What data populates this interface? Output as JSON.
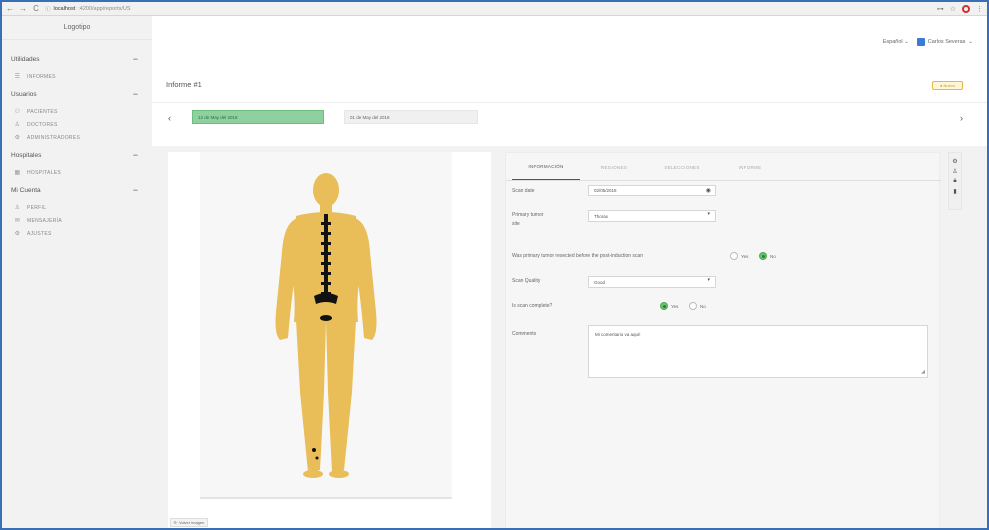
{
  "browser": {
    "host": "localhost",
    "path": ":4200/app/reports/US"
  },
  "sidebar": {
    "logo": "Logotipo",
    "sections": [
      {
        "title": "Utilidades",
        "items": [
          {
            "label": "INFORMES",
            "icon": "list-icon"
          }
        ]
      },
      {
        "title": "Usuarios",
        "items": [
          {
            "label": "PACIENTES",
            "icon": "users-icon"
          },
          {
            "label": "DOCTORES",
            "icon": "user-icon"
          },
          {
            "label": "ADMINISTRADORES",
            "icon": "admin-icon"
          }
        ]
      },
      {
        "title": "Hospitales",
        "items": [
          {
            "label": "HOSPITALES",
            "icon": "hospital-icon"
          }
        ]
      },
      {
        "title": "Mi Cuenta",
        "items": [
          {
            "label": "PERFIL",
            "icon": "user-icon"
          },
          {
            "label": "MENSAJERÍA",
            "icon": "mail-icon"
          },
          {
            "label": "AJUSTES",
            "icon": "gear-icon"
          }
        ]
      }
    ]
  },
  "header": {
    "language": "Español",
    "user": "Carlos Severas"
  },
  "report": {
    "title": "Informe #1",
    "badge": "● Nuevo",
    "dates": [
      "12 de May del 2018",
      "01 de May del 2018"
    ]
  },
  "image_panel": {
    "button": "Volver imagen"
  },
  "form": {
    "tabs": [
      "INFORMACIÓN",
      "REGIONES",
      "SELECCIONES",
      "INFORME"
    ],
    "active_tab": 0,
    "scan_date_label": "Scan date",
    "scan_date_value": "02/05/2018",
    "primary_tumor_label_1": "Primary tumor",
    "primary_tumor_label_2": "site",
    "primary_tumor_value": "Thorax",
    "resected_label": "Was primary tumor resected before the post-induction scan",
    "resected_yes": "Yes",
    "resected_no": "No",
    "resected_selected": "No",
    "scan_quality_label": "Scan Quality",
    "scan_quality_value": "Good",
    "complete_label": "Is scan complete?",
    "complete_yes": "Yes",
    "complete_no": "No",
    "complete_selected": "Yes",
    "comments_label": "Comments",
    "comments_value": "Mi comentario va aquí!"
  },
  "colors": {
    "accent_green": "#8fd19e",
    "body_fill": "#e9bd57",
    "badge": "#e0b84d"
  }
}
